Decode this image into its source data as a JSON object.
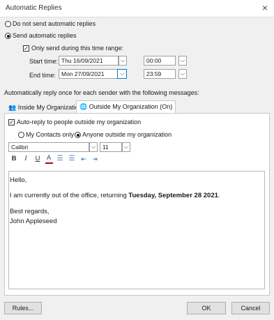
{
  "window": {
    "title": "Automatic Replies",
    "close_icon": "×"
  },
  "options": {
    "no_auto_replies": "Do not send automatic replies",
    "send_auto_replies": "Send automatic replies",
    "selected": "send_auto_replies",
    "time_range_label": "Only send during this time range:",
    "time_range_checked": true
  },
  "start": {
    "label": "Start time:",
    "date": "Thu 16/09/2021",
    "time": "00:00"
  },
  "end": {
    "label": "End time:",
    "date": "Mon 27/09/2021",
    "time": "23:59"
  },
  "reply_instruction": "Automatically reply once for each sender with the following messages:",
  "tabs": [
    {
      "label": "Inside My Organization",
      "icon": "people-icon",
      "active": false
    },
    {
      "label": "Outside My Organization (On)",
      "icon": "globe-icon",
      "active": true
    }
  ],
  "outside": {
    "auto_reply_label": "Auto-reply to people outside my organization",
    "auto_reply_checked": true,
    "my_contacts": "My Contacts only",
    "anyone": "Anyone outside my organization",
    "selected": "anyone"
  },
  "format": {
    "font": "Calibri",
    "size": "11",
    "bold": "B",
    "italic": "I",
    "underline": "U",
    "font_color": "A",
    "accent_underline": "#c00000"
  },
  "message": {
    "greeting": "Hello,",
    "body_prefix": "I am currently out of the office, returning ",
    "body_bold": "Tuesday, September 28 2021",
    "body_suffix": ".",
    "signoff": "Best regards,",
    "name": "John Appleseed"
  },
  "buttons": {
    "rules": "Rules...",
    "ok": "OK",
    "cancel": "Cancel"
  }
}
